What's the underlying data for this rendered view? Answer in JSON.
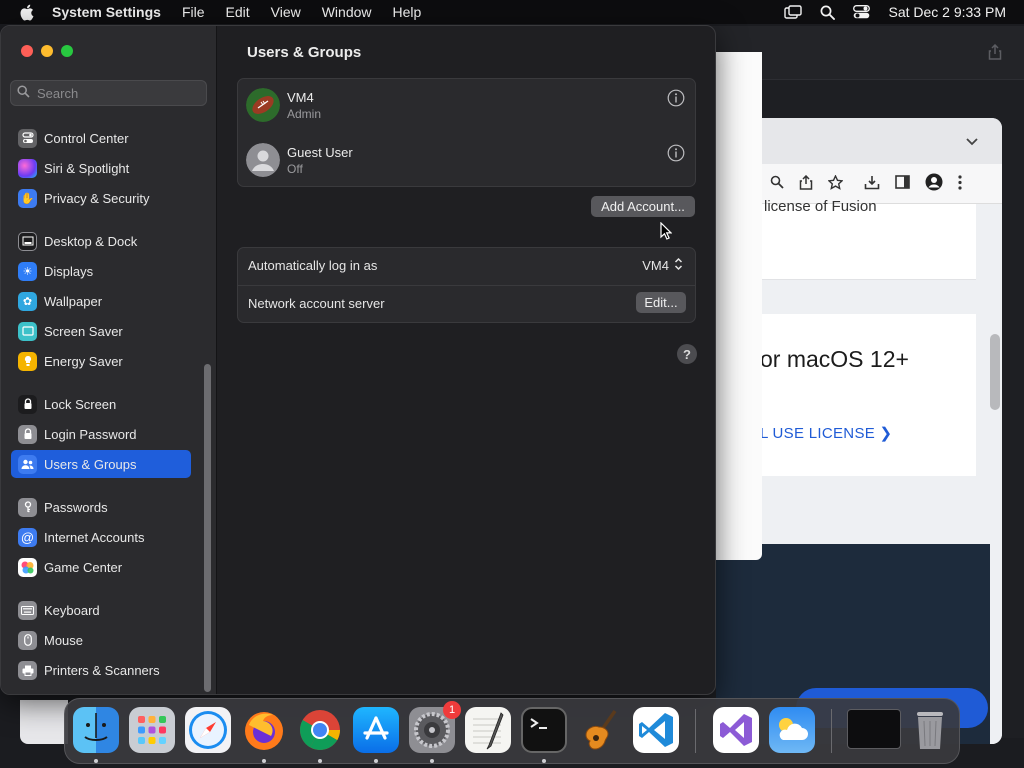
{
  "menubar": {
    "app_name": "System Settings",
    "items": [
      "File",
      "Edit",
      "View",
      "Window",
      "Help"
    ],
    "date_time": "Sat Dec 2  9:33 PM"
  },
  "browser": {
    "card1_text": "license of Fusion",
    "card2_heading": "or macOS 12+",
    "card2_link": "L USE LICENSE"
  },
  "settings": {
    "search_placeholder": "Search",
    "sidebar": [
      {
        "label": "Control Center",
        "icon": "control-center-icon",
        "color": "#6e6e73"
      },
      {
        "label": "Siri & Spotlight",
        "icon": "siri-icon",
        "color": "#b84bd9"
      },
      {
        "label": "Privacy & Security",
        "icon": "hand-icon",
        "color": "#3d7bf0"
      },
      {
        "label": "Desktop & Dock",
        "icon": "dock-icon",
        "color": "#2c2c2e"
      },
      {
        "label": "Displays",
        "icon": "sun-icon",
        "color": "#2f7df6"
      },
      {
        "label": "Wallpaper",
        "icon": "flower-icon",
        "color": "#2fa7e0"
      },
      {
        "label": "Screen Saver",
        "icon": "screen-saver-icon",
        "color": "#3cc1c9"
      },
      {
        "label": "Energy Saver",
        "icon": "bulb-icon",
        "color": "#f5b400"
      },
      {
        "label": "Lock Screen",
        "icon": "lock-icon",
        "color": "#1c1c1e"
      },
      {
        "label": "Login Password",
        "icon": "lock-small-icon",
        "color": "#8e8e93"
      },
      {
        "label": "Users & Groups",
        "icon": "users-icon",
        "color": "#3d7bf0",
        "selected": true
      },
      {
        "label": "Passwords",
        "icon": "key-icon",
        "color": "#8e8e93"
      },
      {
        "label": "Internet Accounts",
        "icon": "at-icon",
        "color": "#3d7bf0"
      },
      {
        "label": "Game Center",
        "icon": "game-center-icon",
        "color": "#ffffff"
      },
      {
        "label": "Keyboard",
        "icon": "keyboard-icon",
        "color": "#8e8e93"
      },
      {
        "label": "Mouse",
        "icon": "mouse-icon",
        "color": "#8e8e93"
      },
      {
        "label": "Printers & Scanners",
        "icon": "printer-icon",
        "color": "#8e8e93"
      }
    ],
    "pane_title": "Users & Groups",
    "users": [
      {
        "name": "VM4",
        "role": "Admin",
        "avatar": "football-avatar"
      },
      {
        "name": "Guest User",
        "role": "Off",
        "avatar": "silhouette-avatar"
      }
    ],
    "add_account_label": "Add Account...",
    "auto_login_label": "Automatically log in as",
    "auto_login_value": "VM4",
    "network_server_label": "Network account server",
    "edit_label": "Edit...",
    "help_label": "?"
  },
  "dock": {
    "apps": [
      "Finder",
      "Launchpad",
      "Safari",
      "Firefox",
      "Chrome",
      "App Store",
      "System Settings",
      "TextEdit",
      "Terminal",
      "GarageBand",
      "Visual Studio Code",
      "Visual Studio",
      "Weather",
      "Window",
      "Trash"
    ],
    "settings_badge": "1"
  }
}
